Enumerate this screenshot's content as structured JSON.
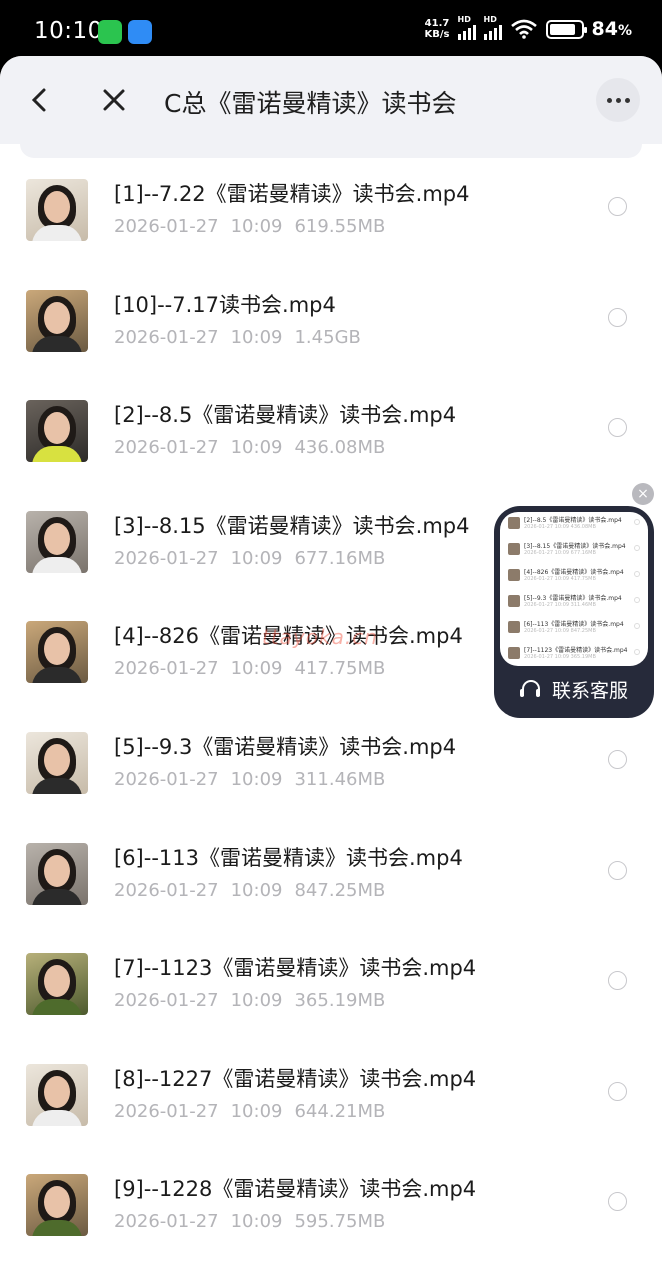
{
  "status_bar": {
    "time": "10:10",
    "speed_value": "41.7",
    "speed_unit": "KB/s",
    "battery_pct": "84",
    "battery_pct_suffix": "%",
    "battery_level": 0.84
  },
  "header": {
    "title": "C总《雷诺曼精读》读书会"
  },
  "files": [
    {
      "name": "[1]--7.22《雷诺曼精读》读书会.mp4",
      "date": "2026-01-27",
      "time": "10:09",
      "size": "619.55MB"
    },
    {
      "name": "[10]--7.17读书会.mp4",
      "date": "2026-01-27",
      "time": "10:09",
      "size": "1.45GB"
    },
    {
      "name": "[2]--8.5《雷诺曼精读》读书会.mp4",
      "date": "2026-01-27",
      "time": "10:09",
      "size": "436.08MB"
    },
    {
      "name": "[3]--8.15《雷诺曼精读》读书会.mp4",
      "date": "2026-01-27",
      "time": "10:09",
      "size": "677.16MB"
    },
    {
      "name": "[4]--826《雷诺曼精读》读书会.mp4",
      "date": "2026-01-27",
      "time": "10:09",
      "size": "417.75MB"
    },
    {
      "name": "[5]--9.3《雷诺曼精读》读书会.mp4",
      "date": "2026-01-27",
      "time": "10:09",
      "size": "311.46MB"
    },
    {
      "name": "[6]--113《雷诺曼精读》读书会.mp4",
      "date": "2026-01-27",
      "time": "10:09",
      "size": "847.25MB"
    },
    {
      "name": "[7]--1123《雷诺曼精读》读书会.mp4",
      "date": "2026-01-27",
      "time": "10:09",
      "size": "365.19MB"
    },
    {
      "name": "[8]--1227《雷诺曼精读》读书会.mp4",
      "date": "2026-01-27",
      "time": "10:09",
      "size": "644.21MB"
    },
    {
      "name": "[9]--1228《雷诺曼精读》读书会.mp4",
      "date": "2026-01-27",
      "time": "10:09",
      "size": "595.75MB"
    }
  ],
  "floating_widget": {
    "label": "联系客服",
    "preview_items": [
      {
        "title": "[2]--8.5《雷诺曼精读》读书会.mp4",
        "meta": "2026-01-27 10:09 436.08MB"
      },
      {
        "title": "[3]--8.15《雷诺曼精读》读书会.mp4",
        "meta": "2026-01-27 10:09 677.16MB"
      },
      {
        "title": "[4]--826《雷诺曼精读》读书会.mp4",
        "meta": "2026-01-27 10:09 417.75MB"
      },
      {
        "title": "[5]--9.3《雷诺曼精读》读书会.mp4",
        "meta": "2026-01-27 10:09 311.46MB"
      },
      {
        "title": "[6]--113《雷诺曼精读》读书会.mp4",
        "meta": "2026-01-27 10:09 847.25MB"
      },
      {
        "title": "[7]--1123《雷诺曼精读》读书会.mp4",
        "meta": "2026-01-27 10:09 365.19MB"
      }
    ]
  },
  "watermark": "ttayoka.cn",
  "icons": {
    "back": "chevron-left-icon",
    "close": "close-icon",
    "more": "more-horizontal-icon",
    "support": "headset-icon"
  }
}
